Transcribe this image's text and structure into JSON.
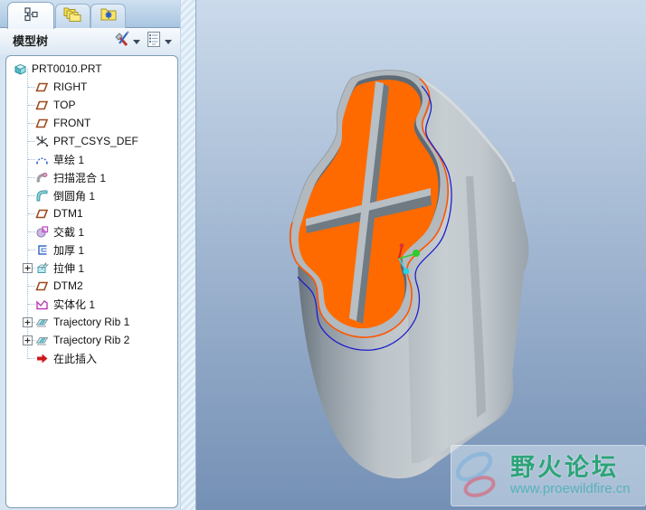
{
  "tabs": [
    {
      "id": "model-tree",
      "icon": "model-tree-tab-icon",
      "active": true
    },
    {
      "id": "folder-browser",
      "icon": "folder-browser-tab-icon",
      "active": false
    },
    {
      "id": "favorites",
      "icon": "favorites-folder-tab-icon",
      "active": false
    }
  ],
  "panel": {
    "title": "模型树",
    "toolbar": [
      {
        "icon": "tools-icon",
        "has_dropdown": true
      },
      {
        "icon": "list-settings-icon",
        "has_dropdown": true
      }
    ]
  },
  "tree": {
    "items": [
      {
        "label": "PRT0010.PRT",
        "icon": "part-icon",
        "level": 0,
        "expandable": false
      },
      {
        "label": "RIGHT",
        "icon": "datum-plane-icon",
        "level": 1,
        "expandable": false
      },
      {
        "label": "TOP",
        "icon": "datum-plane-icon",
        "level": 1,
        "expandable": false
      },
      {
        "label": "FRONT",
        "icon": "datum-plane-icon",
        "level": 1,
        "expandable": false
      },
      {
        "label": "PRT_CSYS_DEF",
        "icon": "csys-icon",
        "level": 1,
        "expandable": false
      },
      {
        "label": "草绘 1",
        "icon": "sketch-icon",
        "level": 1,
        "expandable": false
      },
      {
        "label": "扫描混合 1",
        "icon": "swept-blend-icon",
        "level": 1,
        "expandable": false
      },
      {
        "label": "倒圆角 1",
        "icon": "round-icon",
        "level": 1,
        "expandable": false
      },
      {
        "label": "DTM1",
        "icon": "datum-plane-icon",
        "level": 1,
        "expandable": false
      },
      {
        "label": "交截 1",
        "icon": "intersect-icon",
        "level": 1,
        "expandable": false
      },
      {
        "label": "加厚 1",
        "icon": "thicken-icon",
        "level": 1,
        "expandable": false
      },
      {
        "label": "拉伸 1",
        "icon": "extrude-icon",
        "level": 1,
        "expandable": true
      },
      {
        "label": "DTM2",
        "icon": "datum-plane-icon",
        "level": 1,
        "expandable": false
      },
      {
        "label": "实体化 1",
        "icon": "solidify-icon",
        "level": 1,
        "expandable": false
      },
      {
        "label": "Trajectory Rib 1",
        "icon": "trajectory-rib-icon",
        "level": 1,
        "expandable": true
      },
      {
        "label": "Trajectory Rib 2",
        "icon": "trajectory-rib-icon",
        "level": 1,
        "expandable": true
      },
      {
        "label": "在此插入",
        "icon": "insert-here-icon",
        "level": 1,
        "expandable": false
      }
    ]
  },
  "watermark": {
    "title": "野火论坛",
    "url": "www.proewildfire.cn"
  },
  "viewport": {
    "selected_face_color": "#ff6a00",
    "highlight_edge_blue": "#1f1fc8",
    "highlight_edge_orange": "#ff5500",
    "part_gray": "#b6bec4",
    "background_top": "#cbdaeb",
    "background_bottom": "#7490b5",
    "csys_axis_colors": [
      "#dd2222",
      "#2ecc2e",
      "#22d4e8"
    ]
  }
}
